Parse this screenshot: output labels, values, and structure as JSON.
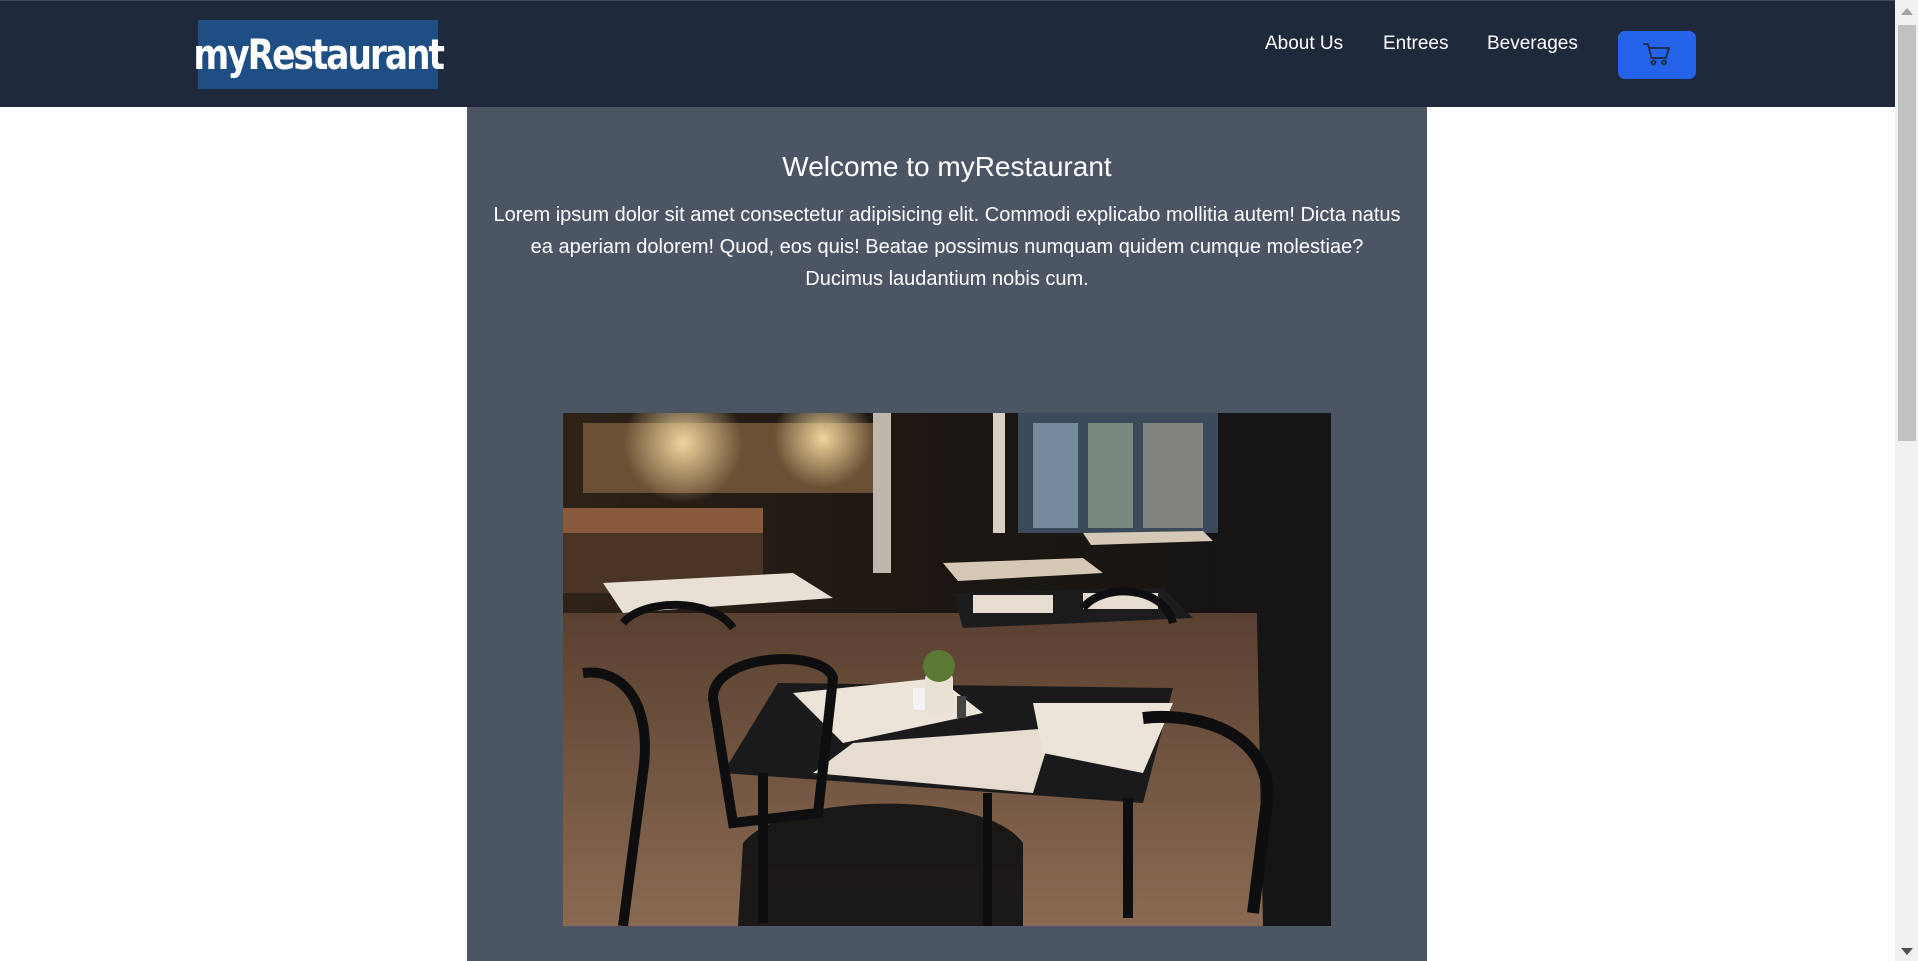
{
  "header": {
    "logo_text": "myRestaurant",
    "nav": {
      "about_label": "About Us",
      "entrees_label": "Entrees",
      "beverages_label": "Beverages"
    },
    "cart_icon": "shopping-cart-icon"
  },
  "main": {
    "title": "Welcome to myRestaurant",
    "intro": "Lorem ipsum dolor sit amet consectetur adipisicing elit. Commodi explicabo mollitia autem! Dicta natus ea aperiam dolorem! Quod, eos quis! Beatae possimus numquam quidem cumque molestiae? Ducimus laudantium nobis cum.",
    "image": {
      "alt": "Restaurant dining room interior with dark wooden tables, chairs and menus"
    }
  },
  "colors": {
    "navbar_bg": "#1e293b",
    "logo_bg": "#1f4e85",
    "cart_button": "#2563eb",
    "panel_bg": "#4b5563",
    "text": "#ffffff"
  }
}
